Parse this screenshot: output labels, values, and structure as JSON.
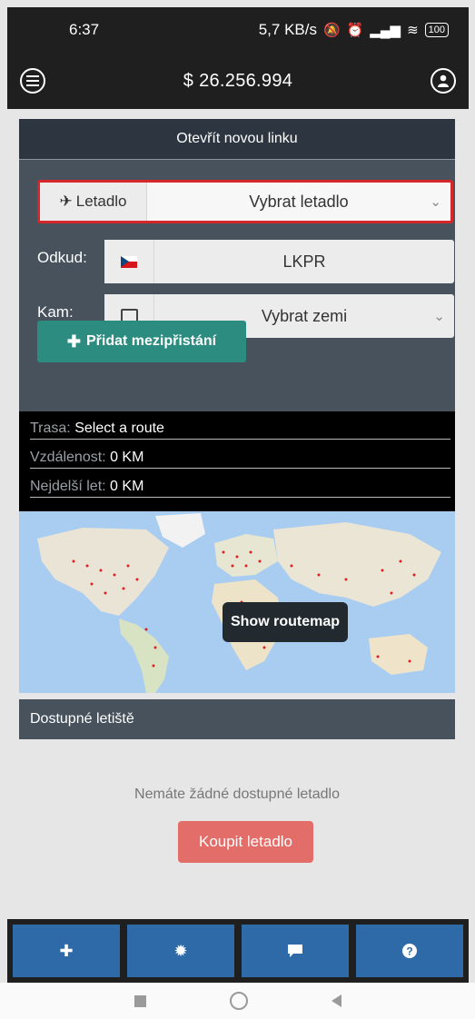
{
  "status_bar": {
    "time": "6:37",
    "speed": "5,7 KB/s",
    "battery": "100"
  },
  "app_bar": {
    "menu_icon": "menu-icon",
    "balance": "$ 26.256.994",
    "profile_icon": "user-icon"
  },
  "new_route": {
    "header": "Otevřít novou linku",
    "aircraft_label": "Letadlo",
    "aircraft_placeholder": "Vybrat letadlo",
    "from_label": "Odkud:",
    "from_value": "LKPR",
    "to_label": "Kam:",
    "to_placeholder": "Vybrat zemi",
    "add_stop_label": "Přidat mezipřistání"
  },
  "route_info": {
    "route_key": "Trasa:",
    "route_value": "Select a route",
    "distance_key": "Vzdálenost:",
    "distance_value": "0 KM",
    "longest_key": "Nejdelší let:",
    "longest_value": "0 KM"
  },
  "map": {
    "routemap_button": "Show routemap"
  },
  "available_airports": {
    "header": "Dostupné letiště",
    "empty_message": "Nemáte žádné dostupné letadlo",
    "buy_button": "Koupit letadlo"
  },
  "bottom_nav": {
    "plus_icon": "plus-icon",
    "settings_icon": "gear-icon",
    "chat_icon": "chat-icon",
    "help_icon": "help-icon"
  },
  "colors": {
    "accent_red": "#d5262c",
    "teal": "#2c8c80",
    "buy": "#e26d69",
    "nav_blue": "#2f6aa8"
  }
}
